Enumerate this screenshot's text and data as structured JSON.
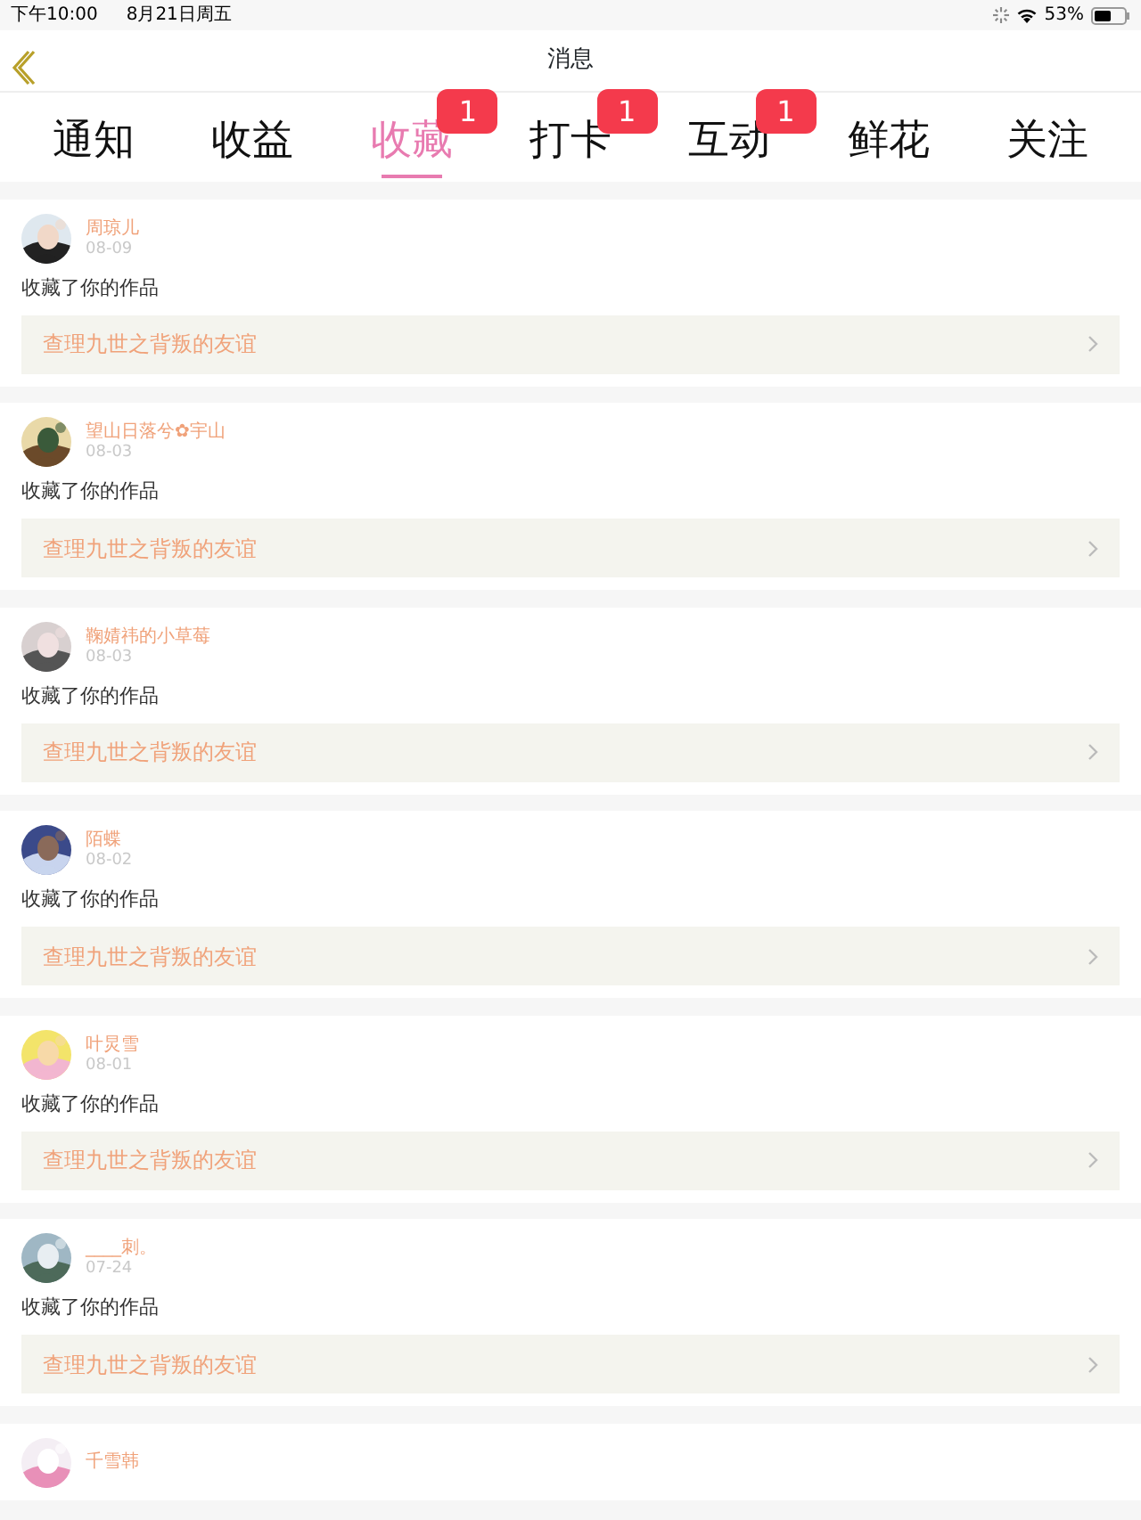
{
  "status_bar": {
    "time": "下午10:00",
    "date": "8月21日周五",
    "battery": "53%"
  },
  "header": {
    "title": "消息"
  },
  "tabs": [
    {
      "label": "通知",
      "selected": false
    },
    {
      "label": "收益",
      "selected": false
    },
    {
      "label": "收藏",
      "selected": true,
      "badge": "1"
    },
    {
      "label": "打卡",
      "selected": false,
      "badge": "1"
    },
    {
      "label": "互动",
      "selected": false,
      "badge": "1"
    },
    {
      "label": "鲜花",
      "selected": false
    },
    {
      "label": "关注",
      "selected": false
    }
  ],
  "items": [
    {
      "user": "周琼儿",
      "date": "08-09",
      "action": "收藏了你的作品",
      "work": "查理九世之背叛的友谊"
    },
    {
      "user": "望山日落兮✿宇山",
      "date": "08-03",
      "action": "收藏了你的作品",
      "work": "查理九世之背叛的友谊"
    },
    {
      "user": "鞠婧祎的小草莓",
      "date": "08-03",
      "action": "收藏了你的作品",
      "work": "查理九世之背叛的友谊"
    },
    {
      "user": "陌蝶",
      "date": "08-02",
      "action": "收藏了你的作品",
      "work": "查理九世之背叛的友谊"
    },
    {
      "user": "叶炅雪",
      "date": "08-01",
      "action": "收藏了你的作品",
      "work": "查理九世之背叛的友谊"
    },
    {
      "user": "____刺。",
      "date": "07-24",
      "action": "收藏了你的作品",
      "work": "查理九世之背叛的友谊"
    },
    {
      "user": "千雪韩"
    }
  ]
}
